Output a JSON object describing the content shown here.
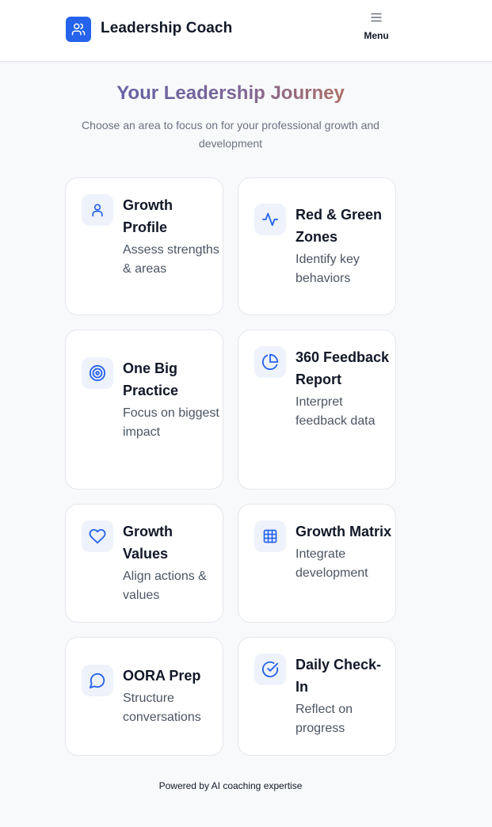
{
  "header": {
    "title": "Leadership Coach",
    "menu_label": "Menu"
  },
  "hero": {
    "title": "Your Leadership Journey",
    "subtitle": "Choose an area to focus on for your professional growth and development"
  },
  "cards": [
    {
      "title": "Growth Profile",
      "description": "Assess strengths & areas",
      "icon": "user-icon"
    },
    {
      "title": "Red & Green Zones",
      "description": "Identify key behaviors",
      "icon": "activity-icon"
    },
    {
      "title": "One Big Practice",
      "description": "Focus on biggest impact",
      "icon": "target-icon"
    },
    {
      "title": "360 Feedback Report",
      "description": "Interpret feedback data",
      "icon": "pie-chart-icon"
    },
    {
      "title": "Growth Values",
      "description": "Align actions & values",
      "icon": "heart-icon"
    },
    {
      "title": "Growth Matrix",
      "description": "Integrate development",
      "icon": "grid-icon"
    },
    {
      "title": "OORA Prep",
      "description": "Structure conversations",
      "icon": "message-circle-icon"
    },
    {
      "title": "Daily Check-In",
      "description": "Reflect on progress",
      "icon": "check-circle-icon"
    }
  ],
  "footer": {
    "text": "Powered by AI coaching expertise"
  },
  "colors": {
    "accent": "#2563eb",
    "icon_bg": "#eef2fb",
    "title_gradient": [
      "#4f5fb0",
      "#e07a34"
    ]
  }
}
